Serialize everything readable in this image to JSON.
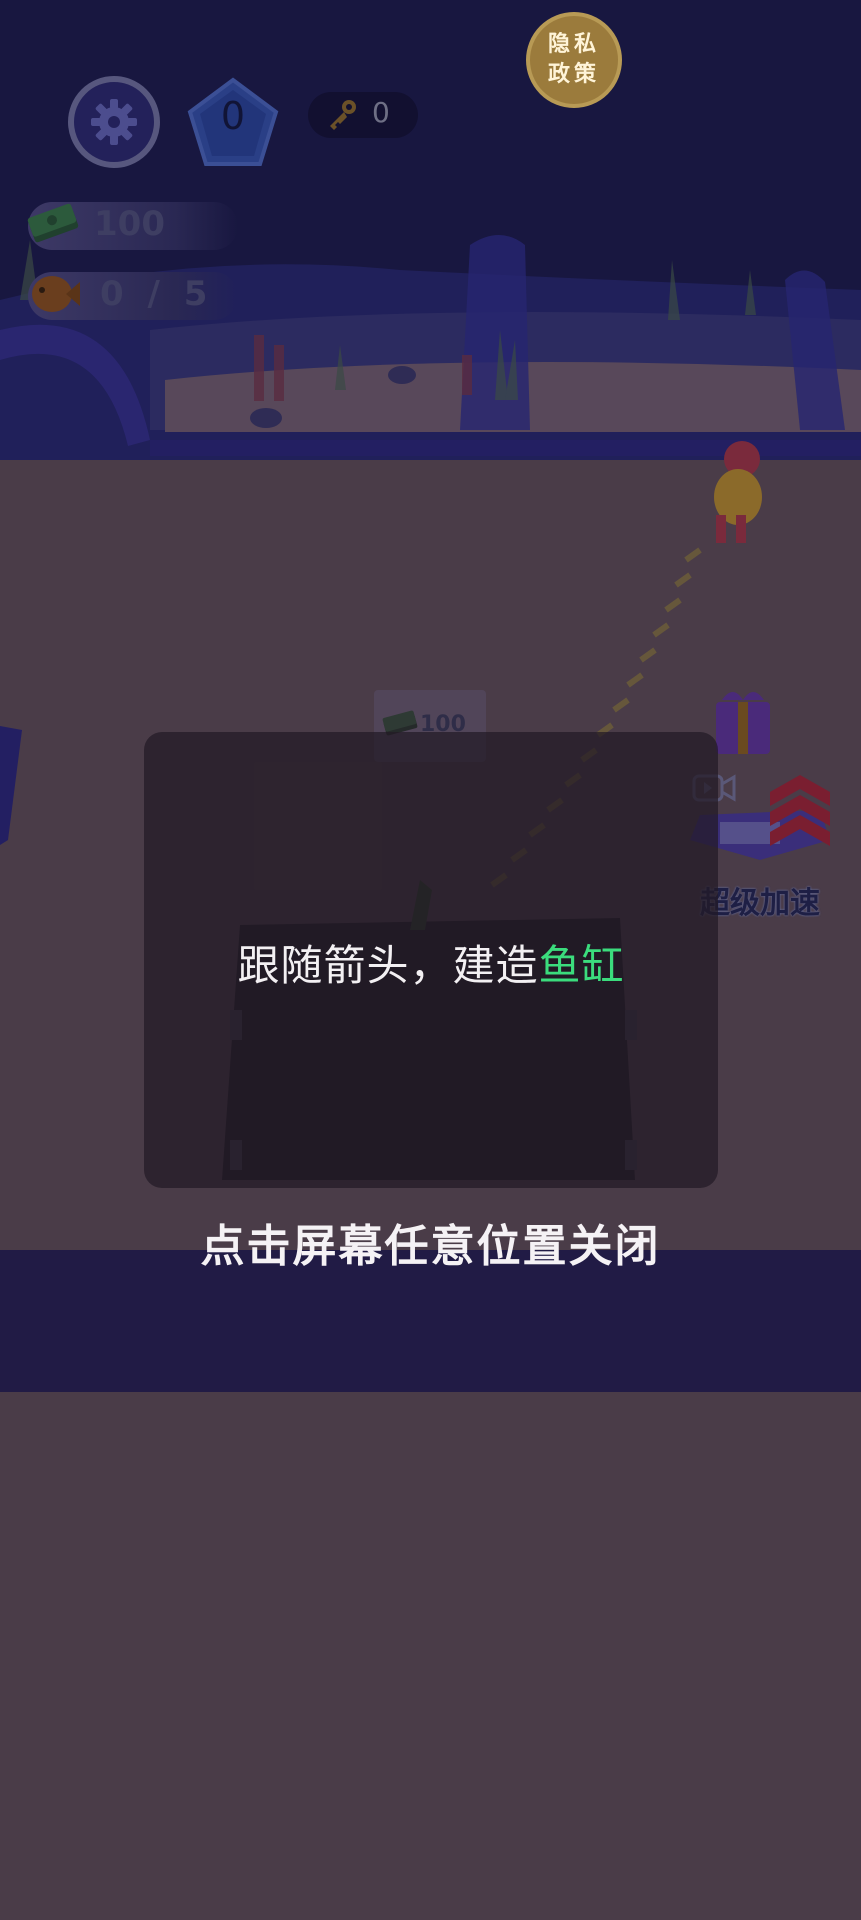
{
  "hud": {
    "gems": "0",
    "keys": "0",
    "cash": "100",
    "fish_progress": "0 / 5",
    "privacy_line1": "隐私",
    "privacy_line2": "政策"
  },
  "side": {
    "speed_boost_label": "超级加速"
  },
  "build_site": {
    "cost": "100"
  },
  "dialog": {
    "message_prefix": "跟随箭头，建造",
    "message_highlight": "鱼缸",
    "close_hint": "点击屏幕任意位置关闭"
  },
  "colors": {
    "highlight": "#3bdc7d",
    "night_sky": "#181740",
    "floor": "#4a3c48"
  }
}
